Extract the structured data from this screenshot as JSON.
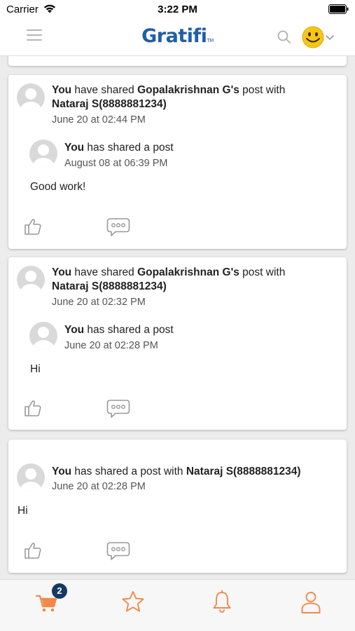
{
  "status_bar": {
    "carrier": "Carrier",
    "time": "3:22 PM"
  },
  "header": {
    "logo_text": "Gratifi",
    "logo_tm": "TM"
  },
  "colors": {
    "brand_blue": "#1f5fa8",
    "accent_orange": "#f08a4b",
    "badge_navy": "#123a63",
    "smiley_yellow": "#f7c514"
  },
  "feed": {
    "cards": [
      {
        "actor": "You",
        "verb": " have shared ",
        "owner": "Gopalakrishnan G's",
        "mid": " post with",
        "target": "Nataraj S(8888881234)",
        "time": "June 20 at 02:44 PM",
        "inner_actor": "You",
        "inner_text": " has shared a post",
        "inner_time": "August 08 at 06:39 PM",
        "message": "Good work!"
      },
      {
        "actor": "You",
        "verb": " have shared ",
        "owner": "Gopalakrishnan G's",
        "mid": " post with",
        "target": "Nataraj S(8888881234)",
        "time": "June 20 at 02:32 PM",
        "inner_actor": "You",
        "inner_text": " has shared a post",
        "inner_time": "June 20 at 02:28 PM",
        "message": "Hi"
      },
      {
        "actor": "You",
        "verb": " has shared a post with ",
        "target": "Nataraj S(8888881234)",
        "time": "June 20 at 02:28 PM",
        "message": "Hi"
      }
    ]
  },
  "tab_bar": {
    "cart_badge": "2",
    "tabs": [
      "cart-icon",
      "star-icon",
      "bell-icon",
      "person-icon"
    ]
  }
}
